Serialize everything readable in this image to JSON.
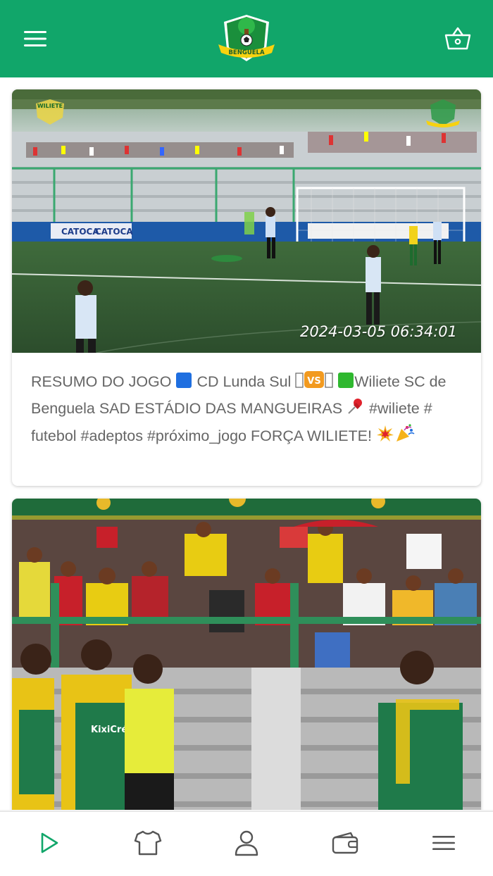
{
  "header": {
    "menu_icon": "hamburger-menu-icon",
    "logo_text": "BENGUELA",
    "cart_icon": "shopping-basket-icon",
    "brand_color": "#11a66a"
  },
  "feed": {
    "posts": [
      {
        "timestamp": "2024-03-05 06:34:01",
        "logo_left_text": "WILIETE",
        "ad_board_1": "CATOCA",
        "ad_board_2": "CATOCA",
        "caption_part1": "RESUMO DO JOGO ",
        "caption_part2": " CD Lunda Sul ",
        "caption_vs": "VS",
        "caption_part3": "Wiliete SC de Benguela SAD ESTÁDIO DAS MANGUEIRAS ",
        "caption_part4": " #wiliete # futebol #adeptos #próximo_jogo FORÇA WILIETE! "
      },
      {
        "jersey_text": "KixiCrédito"
      }
    ]
  },
  "tabbar": {
    "tabs": [
      {
        "icon": "play-icon",
        "active": true
      },
      {
        "icon": "shirt-icon",
        "active": false
      },
      {
        "icon": "user-icon",
        "active": false
      },
      {
        "icon": "wallet-icon",
        "active": false
      },
      {
        "icon": "menu-icon",
        "active": false
      }
    ],
    "active_color": "#11a66a",
    "inactive_color": "#555555"
  }
}
